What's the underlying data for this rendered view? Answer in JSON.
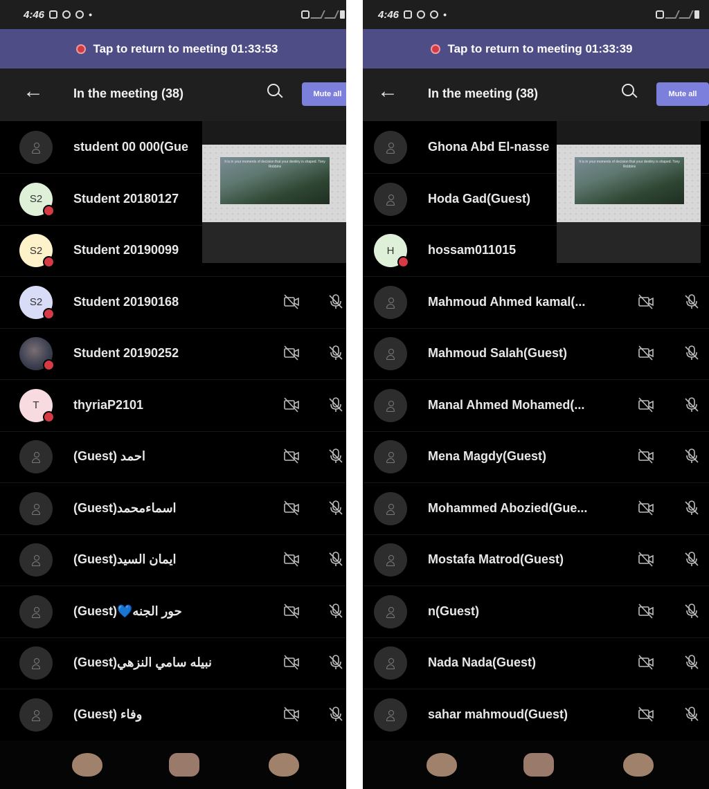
{
  "left": {
    "status": {
      "time": "4:46",
      "dot": "•"
    },
    "banner": {
      "text": "Tap to return to meeting 01:33:53"
    },
    "header": {
      "back": "←",
      "title": "In the meeting (38)",
      "mute_all": "Mute all"
    },
    "participants": [
      {
        "name": "student 00 000(Gue",
        "avatar": "guest-icon",
        "initials": "",
        "color": "#2d2d2d",
        "icons": false
      },
      {
        "name": "Student 20180127",
        "avatar": "initials",
        "initials": "S2",
        "color": "#dff0d8",
        "icons": false
      },
      {
        "name": "Student 20190099",
        "avatar": "initials",
        "initials": "S2",
        "color": "#fdf2c9",
        "icons": false
      },
      {
        "name": "Student 20190168",
        "avatar": "initials",
        "initials": "S2",
        "color": "#d9dcf6",
        "icons": true
      },
      {
        "name": "Student 20190252",
        "avatar": "photo",
        "initials": "",
        "color": "#3d4152",
        "icons": true
      },
      {
        "name": "thyriaP2101",
        "avatar": "initials",
        "initials": "T",
        "color": "#f7dbe0",
        "icons": true
      },
      {
        "name": "(Guest) احمد",
        "avatar": "guest-icon",
        "initials": "",
        "color": "#2d2d2d",
        "icons": true
      },
      {
        "name": "(Guest)اسماءمحمد",
        "avatar": "guest-icon",
        "initials": "",
        "color": "#2d2d2d",
        "icons": true
      },
      {
        "name": "(Guest)ايمان السيد",
        "avatar": "guest-icon",
        "initials": "",
        "color": "#2d2d2d",
        "icons": true
      },
      {
        "name": "(Guest)💙حور الجنه",
        "avatar": "guest-icon",
        "initials": "",
        "color": "#2d2d2d",
        "icons": true
      },
      {
        "name": "(Guest)نبيله سامي النزهي",
        "avatar": "guest-icon",
        "initials": "",
        "color": "#2d2d2d",
        "icons": true
      },
      {
        "name": "(Guest) وفاء",
        "avatar": "guest-icon",
        "initials": "",
        "color": "#2d2d2d",
        "icons": true
      }
    ]
  },
  "right": {
    "status": {
      "time": "4:46",
      "dot": "•"
    },
    "banner": {
      "text": "Tap to return to meeting 01:33:39"
    },
    "header": {
      "back": "←",
      "title": "In the meeting (38)",
      "mute_all": "Mute all"
    },
    "participants": [
      {
        "name": "Ghona Abd El-nasse",
        "avatar": "guest-icon",
        "initials": "",
        "color": "#2d2d2d",
        "icons": false
      },
      {
        "name": "Hoda Gad(Guest)",
        "avatar": "guest-icon",
        "initials": "",
        "color": "#2d2d2d",
        "icons": false
      },
      {
        "name": "hossam011015",
        "avatar": "initials",
        "initials": "H",
        "color": "#dff0d8",
        "icons": false
      },
      {
        "name": "Mahmoud Ahmed kamal(...",
        "avatar": "guest-icon",
        "initials": "",
        "color": "#2d2d2d",
        "icons": true
      },
      {
        "name": "Mahmoud Salah(Guest)",
        "avatar": "guest-icon",
        "initials": "",
        "color": "#2d2d2d",
        "icons": true
      },
      {
        "name": "Manal Ahmed Mohamed(...",
        "avatar": "guest-icon",
        "initials": "",
        "color": "#2d2d2d",
        "icons": true
      },
      {
        "name": "Mena Magdy(Guest)",
        "avatar": "guest-icon",
        "initials": "",
        "color": "#2d2d2d",
        "icons": true
      },
      {
        "name": "Mohammed Abozied(Gue...",
        "avatar": "guest-icon",
        "initials": "",
        "color": "#2d2d2d",
        "icons": true
      },
      {
        "name": "Mostafa Matrod(Guest)",
        "avatar": "guest-icon",
        "initials": "",
        "color": "#2d2d2d",
        "icons": true
      },
      {
        "name": "n(Guest)",
        "avatar": "guest-icon",
        "initials": "",
        "color": "#2d2d2d",
        "icons": true
      },
      {
        "name": "Nada Nada(Guest)",
        "avatar": "guest-icon",
        "initials": "",
        "color": "#2d2d2d",
        "icons": true
      },
      {
        "name": "sahar mahmoud(Guest)",
        "avatar": "guest-icon",
        "initials": "",
        "color": "#2d2d2d",
        "icons": true
      }
    ]
  },
  "shared_screen": {
    "slide_text": "It is in your moments of decision that your destiny is shaped. Tony Robbins"
  },
  "colors": {
    "banner": "#4f4d86",
    "accent": "#7c7fdc",
    "presence_dot": "#d53a45"
  }
}
